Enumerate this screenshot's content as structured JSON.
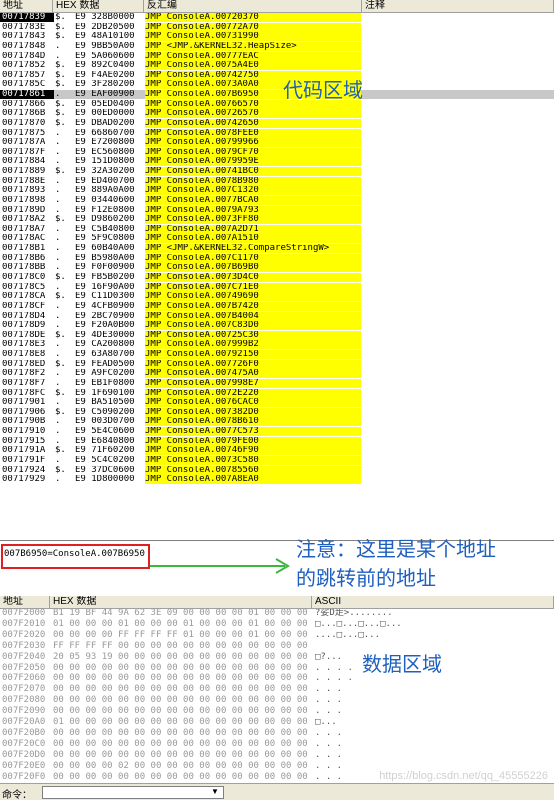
{
  "disasm_headers": {
    "addr": "地址",
    "hex": "HEX 数据",
    "dis": "反汇编",
    "comment": "注释"
  },
  "disasm_rows": [
    [
      "00717839",
      "$.",
      "E9 328B0000",
      "JMP ConsoleA.00720370"
    ],
    [
      "0071783E",
      "$.",
      "E9 2DB20500",
      "JMP ConsoleA.00772A70"
    ],
    [
      "00717843",
      "$.",
      "E9 48A10100",
      "JMP ConsoleA.00731990"
    ],
    [
      "00717848",
      ".",
      "E9 9BB50A00",
      "JMP <JMP.&KERNEL32.HeapSize>"
    ],
    [
      "0071784D",
      ".",
      "E9 5A060600",
      "JMP ConsoleA.00777EAC"
    ],
    [
      "00717852",
      "$.",
      "E9 892C0400",
      "JMP ConsoleA.0075A4E0"
    ],
    [
      "00717857",
      "$.",
      "E9 F4AE0200",
      "JMP ConsoleA.00742750"
    ],
    [
      "0071785C",
      "$.",
      "E9 3F280200",
      "JMP ConsoleA.0073A0A0"
    ],
    [
      "00717861",
      ".",
      "E9 EAF00900",
      "JMP ConsoleA.007B6950"
    ],
    [
      "00717866",
      "$.",
      "E9 05ED0400",
      "JMP ConsoleA.00766570"
    ],
    [
      "0071786B",
      "$.",
      "E9 00ED0000",
      "JMP ConsoleA.00726570"
    ],
    [
      "00717870",
      "$.",
      "E9 DBAD0200",
      "JMP ConsoleA.00742650"
    ],
    [
      "00717875",
      ".",
      "E9 66860700",
      "JMP ConsoleA.0078FEE0"
    ],
    [
      "0071787A",
      ".",
      "E9 E7200800",
      "JMP ConsoleA.00799966"
    ],
    [
      "0071787F",
      ".",
      "E9 EC560800",
      "JMP ConsoleA.0079CF70"
    ],
    [
      "00717884",
      ".",
      "E9 151D0800",
      "JMP ConsoleA.0079959E"
    ],
    [
      "00717889",
      "$.",
      "E9 32A30200",
      "JMP ConsoleA.00741BC0"
    ],
    [
      "0071788E",
      ".",
      "E9 ED400700",
      "JMP ConsoleA.0078B980"
    ],
    [
      "00717893",
      ".",
      "E9 889A0A00",
      "JMP ConsoleA.007C1320"
    ],
    [
      "00717898",
      ".",
      "E9 03440600",
      "JMP ConsoleA.0077BCA0"
    ],
    [
      "0071789D",
      ".",
      "E9 F12E0800",
      "JMP ConsoleA.0079A793"
    ],
    [
      "007178A2",
      "$.",
      "E9 D9860200",
      "JMP ConsoleA.0073FF80"
    ],
    [
      "007178A7",
      ".",
      "E9 C5B40800",
      "JMP ConsoleA.007A2D71"
    ],
    [
      "007178AC",
      ".",
      "E9 5F9C0800",
      "JMP ConsoleA.007A1510"
    ],
    [
      "007178B1",
      ".",
      "E9 60B40A00",
      "JMP <JMP.&KERNEL32.CompareStringW>"
    ],
    [
      "007178B6",
      ".",
      "E9 B5980A00",
      "JMP ConsoleA.007C1170"
    ],
    [
      "007178BB",
      ".",
      "E9 F0F00900",
      "JMP ConsoleA.007B69B0"
    ],
    [
      "007178C0",
      "$.",
      "E9 FB5B0200",
      "JMP ConsoleA.0073D4C0"
    ],
    [
      "007178C5",
      ".",
      "E9 16F90A00",
      "JMP ConsoleA.007C71E0"
    ],
    [
      "007178CA",
      "$.",
      "E9 C11D0300",
      "JMP ConsoleA.00749690"
    ],
    [
      "007178CF",
      ".",
      "E9 4CFB0900",
      "JMP ConsoleA.007B7420"
    ],
    [
      "007178D4",
      ".",
      "E9 2BC70900",
      "JMP ConsoleA.007B4004"
    ],
    [
      "007178D9",
      ".",
      "E9 F20A0B00",
      "JMP ConsoleA.007C83D0"
    ],
    [
      "007178DE",
      "$.",
      "E9 4DE30000",
      "JMP ConsoleA.00725C30"
    ],
    [
      "007178E3",
      ".",
      "E9 CA200800",
      "JMP ConsoleA.007999B2"
    ],
    [
      "007178E8",
      ".",
      "E9 63A80700",
      "JMP ConsoleA.00792150"
    ],
    [
      "007178ED",
      "$.",
      "E9 FEAD0500",
      "JMP ConsoleA.007726F0"
    ],
    [
      "007178F2",
      ".",
      "E9 A9FC0200",
      "JMP ConsoleA.007475A0"
    ],
    [
      "007178F7",
      ".",
      "E9 EB1F0800",
      "JMP ConsoleA.007998E7"
    ],
    [
      "007178FC",
      "$.",
      "E9 1F690100",
      "JMP ConsoleA.0072E220"
    ],
    [
      "00717901",
      ".",
      "E9 BA510500",
      "JMP ConsoleA.0076CAC0"
    ],
    [
      "00717906",
      "$.",
      "E9 C5090200",
      "JMP ConsoleA.007382D0"
    ],
    [
      "0071790B",
      ".",
      "E9 003D0700",
      "JMP ConsoleA.0078B610"
    ],
    [
      "00717910",
      ".",
      "E9 5E4C0600",
      "JMP ConsoleA.0077C573"
    ],
    [
      "00717915",
      ".",
      "E9 E6840800",
      "JMP ConsoleA.0079FE00"
    ],
    [
      "0071791A",
      "$.",
      "E9 71F60200",
      "JMP ConsoleA.00746F90"
    ],
    [
      "0071791F",
      ".",
      "E9 5C4C0200",
      "JMP ConsoleA.0073C580"
    ],
    [
      "00717924",
      "$.",
      "E9 37DC0600",
      "JMP ConsoleA.00785560"
    ],
    [
      "00717929",
      ".",
      "E9 1D800000",
      "JMP ConsoleA.007A8EA0"
    ]
  ],
  "info_text": "007B6950=ConsoleA.007B6950",
  "annotations": {
    "code_region": "代码区域",
    "note_line1": "注意：这里是某个地址",
    "note_line2": "的跳转前的地址",
    "data_region": "数据区域"
  },
  "dump_headers": {
    "addr": "地址",
    "hex": "HEX 数据",
    "ascii": "ASCII"
  },
  "dump_rows": [
    [
      "007F2000",
      "B1 19 BF 44 9A 62 3E 09 00 00 00 00 01 00 00 00",
      "?娑D歨>........"
    ],
    [
      "007F2010",
      "01 00 00 00 01 00 00 00 01 00 00 00 01 00 00 00",
      "□...□...□...□..."
    ],
    [
      "007F2020",
      "00 00 00 00 FF FF FF FF 01 00 00 00 01 00 00 00",
      "....□...□..."
    ],
    [
      "007F2030",
      "FF FF FF FF 00 00 00 00 00 00 00 00 00 00 00 00",
      ""
    ],
    [
      "007F2040",
      "20 05 93 19 00 00 00 00 00 00 00 00 00 00 00 00",
      "□?..."
    ],
    [
      "007F2050",
      "00 00 00 00 00 00 00 00 00 00 00 00 00 00 00 00",
      ". . . ."
    ],
    [
      "007F2060",
      "00 00 00 00 00 00 00 00 00 00 00 00 00 00 00 00",
      ". . . ."
    ],
    [
      "007F2070",
      "00 00 00 00 00 00 00 00 00 00 00 00 00 00 00 00",
      ". . ."
    ],
    [
      "007F2080",
      "00 00 00 00 00 00 00 00 00 00 00 00 00 00 00 00",
      ". . ."
    ],
    [
      "007F2090",
      "00 00 00 00 00 00 00 00 00 00 00 00 00 00 00 00",
      ". . ."
    ],
    [
      "007F20A0",
      "01 00 00 00 00 00 00 00 00 00 00 00 00 00 00 00",
      "□..."
    ],
    [
      "007F20B0",
      "00 00 00 00 00 00 00 00 00 00 00 00 00 00 00 00",
      ". . ."
    ],
    [
      "007F20C0",
      "00 00 00 00 00 00 00 00 00 00 00 00 00 00 00 00",
      ". . ."
    ],
    [
      "007F20D0",
      "00 00 00 00 00 00 00 00 00 00 00 00 00 00 00 00",
      ". . ."
    ],
    [
      "007F20E0",
      "00 00 00 00 02 00 00 00 00 00 00 00 00 00 00 00",
      ". . ."
    ],
    [
      "007F20F0",
      "00 00 00 00 00 00 00 00 00 00 00 00 00 00 00 00",
      ". . ."
    ]
  ],
  "cmd_label": "命令：",
  "watermark": "https://blog.csdn.net/qq_45555226",
  "colors": {
    "highlight": "#ffff00",
    "annotation": "#1f5fbf",
    "redbox": "#e02020",
    "arrow": "#3cb83c"
  }
}
